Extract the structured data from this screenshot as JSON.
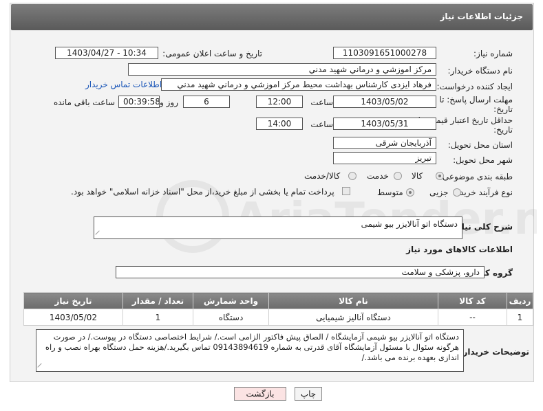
{
  "header": {
    "title": "جزئیات اطلاعات نیاز"
  },
  "fields": {
    "need_number_label": "شماره نیاز:",
    "need_number": "1103091651000278",
    "announce_label": "تاریخ و ساعت اعلان عمومی:",
    "announce_value": "1403/04/27 - 10:34",
    "buyer_label": "نام دستگاه خریدار:",
    "buyer_value": "مرکز اموزشي و درماني شهيد مدني",
    "creator_label": "ایجاد کننده درخواست:",
    "creator_value": "فرهاد ایزدی کارشناس بهداشت محیط مرکز اموزشي و درماني شهيد مدني",
    "contact_link": "اطلاعات تماس خریدار",
    "deadline_label_1": "مهلت ارسال پاسخ: تا",
    "deadline_label_2": "تاریخ:",
    "deadline_date": "1403/05/02",
    "time_label": "ساعت",
    "deadline_time": "12:00",
    "days_value": "6",
    "days_label": "روز و",
    "remaining_time": "00:39:58",
    "remaining_label": "ساعت باقی مانده",
    "validity_label_1": "حداقل تاریخ اعتبار قیمت: تا",
    "validity_label_2": "تاریخ:",
    "validity_date": "1403/05/31",
    "validity_time": "14:00",
    "province_label": "استان محل تحویل:",
    "province_value": "آذربایجان شرقی",
    "city_label": "شهر محل تحویل:",
    "city_value": "تبریز",
    "category_label": "طبقه بندی موضوعی:",
    "category_options": [
      "کالا",
      "خدمت",
      "کالا/خدمت"
    ],
    "process_label": "نوع فرآیند خرید :",
    "process_options": [
      "جزیی",
      "متوسط"
    ],
    "payment_note": "پرداخت تمام یا بخشی از مبلغ خرید،از محل \"اسناد خزانه اسلامی\" خواهد بود.",
    "summary_label": "شرح کلی نیاز:",
    "summary_value": "دستگاه اتو آنالایزر بیو شیمی",
    "goods_info_title": "اطلاعات کالاهای مورد نیاز",
    "goods_group_label": "گروه کالا:",
    "goods_group_value": "دارو، پزشکی و سلامت"
  },
  "table": {
    "headers": [
      "ردیف",
      "کد کالا",
      "نام کالا",
      "واحد شمارش",
      "تعداد / مقدار",
      "تاریخ نیاز"
    ],
    "rows": [
      [
        "1",
        "--",
        "دستگاه آنالیز شیمیایی",
        "دستگاه",
        "1",
        "1403/05/02"
      ]
    ]
  },
  "buyer_notes_label": "توضیحات خریدار:",
  "buyer_notes": "دستگاه اتو آنالایزر بیو شیمی آزمایشگاه / الصاق پیش فاکتور الزامی است./ شرایط اختصاصی دستگاه در پیوست./ در صورت هرگونه سئوال با مسئول آزمایشگاه آقای قدرتی به شماره 09143894619 تماس بگیرید./هزینه حمل دستگاه بهراه نصب و راه اندازی بعهده برنده می باشد./",
  "buttons": {
    "print": "چاپ",
    "back": "بازگشت"
  },
  "watermark_text": "AriaTender.net",
  "colors": {
    "titlebar": "#666666",
    "back_button_bg": "#fbe3e3",
    "link": "#1a56b8"
  }
}
